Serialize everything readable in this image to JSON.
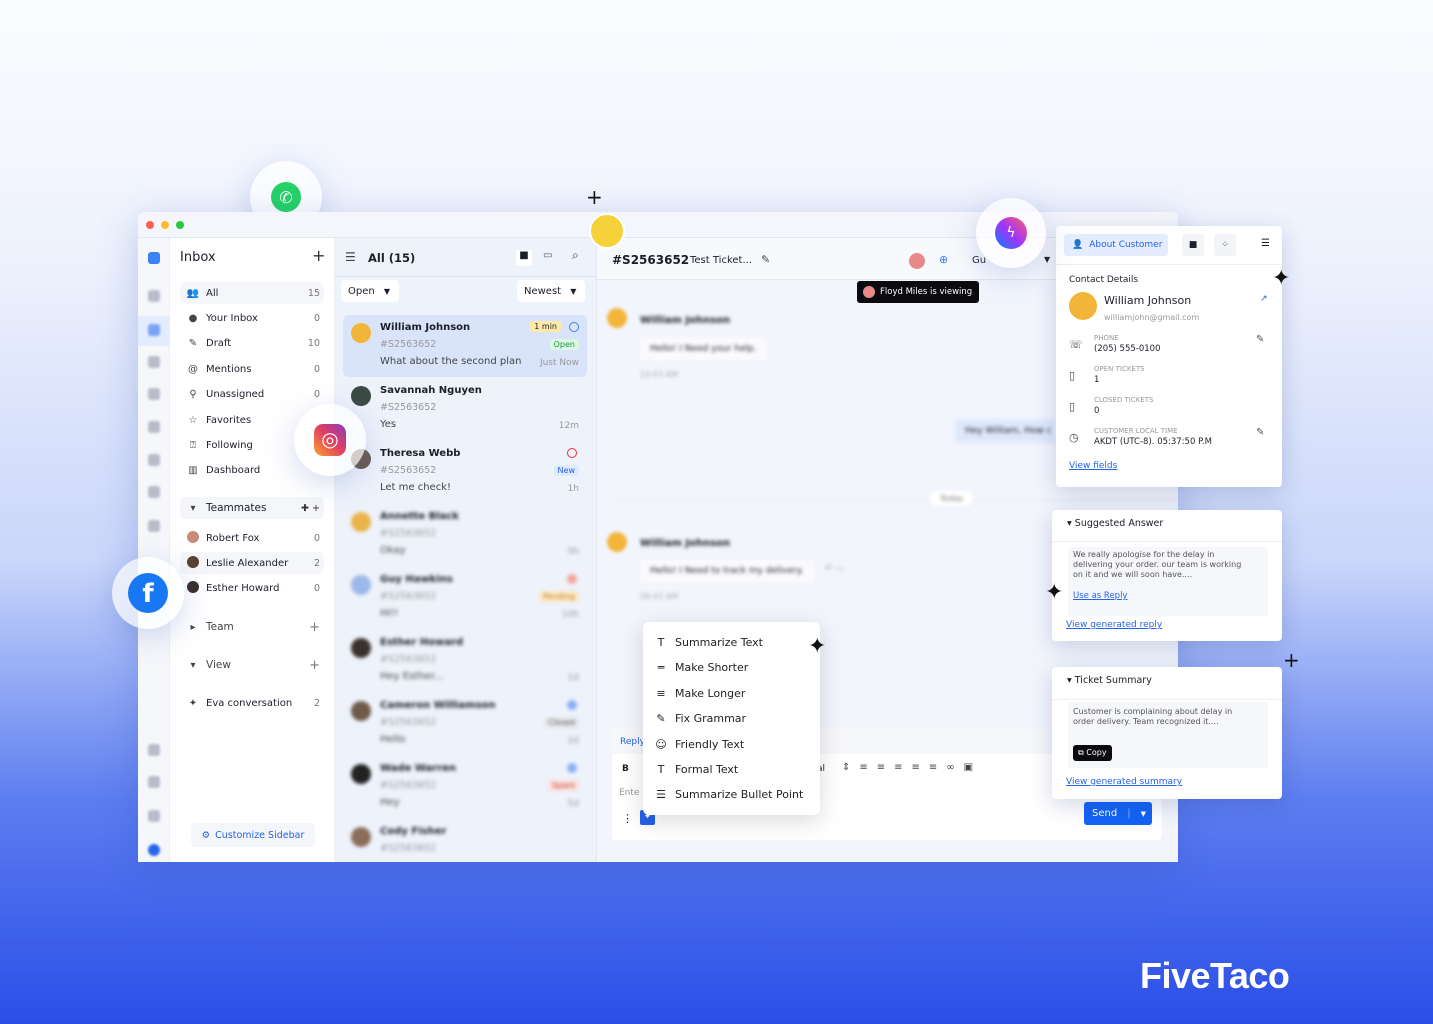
{
  "brand": "FiveTaco",
  "sidebar": {
    "title": "Inbox",
    "items": [
      {
        "label": "All",
        "count": "15",
        "icon": "users-icon"
      },
      {
        "label": "Your Inbox",
        "count": "0",
        "icon": "inbox-icon"
      },
      {
        "label": "Draft",
        "count": "10",
        "icon": "draft-icon"
      },
      {
        "label": "Mentions",
        "count": "0",
        "icon": "at-icon"
      },
      {
        "label": "Unassigned",
        "count": "0",
        "icon": "unassigned-icon"
      },
      {
        "label": "Favorites",
        "count": "",
        "icon": "star-icon"
      },
      {
        "label": "Following",
        "count": "",
        "icon": "following-icon"
      },
      {
        "label": "Dashboard",
        "count": "",
        "icon": "chart-icon"
      }
    ],
    "teammates_label": "Teammates",
    "teammates": [
      {
        "name": "Robert Fox",
        "count": "0"
      },
      {
        "name": "Leslie Alexander",
        "count": "2"
      },
      {
        "name": "Esther Howard",
        "count": "0"
      }
    ],
    "team_label": "Team",
    "view_label": "View",
    "eva_label": "Eva conversation",
    "eva_count": "2",
    "customize_label": "Customize Sidebar"
  },
  "list": {
    "title": "All (15)",
    "filter": "Open",
    "sort": "Newest",
    "conversations": [
      {
        "name": "William Johnson",
        "ticket": "#S2563652",
        "message": "What about the second plan",
        "time": "Just Now",
        "badge": "Open",
        "timer": "1 min",
        "badge_color": "#1a9a4a",
        "badge_bg": "#dcf7e3",
        "avatar": "#f2b53a"
      },
      {
        "name": "Savannah Nguyen",
        "ticket": "#S2563652",
        "message": "Yes",
        "time": "12m",
        "badge": "",
        "avatar": "#3b4a44"
      },
      {
        "name": "Theresa Webb",
        "ticket": "#S2563652",
        "message": "Let me check!",
        "time": "1h",
        "badge": "New",
        "badge_color": "#2563eb",
        "badge_bg": "#e0eaff",
        "avatar": "#6b5a4e",
        "status": "#e33"
      },
      {
        "name": "Annette Black",
        "ticket": "#S2563652",
        "message": "Okay",
        "time": "5h",
        "badge": "",
        "avatar": "#e8b44a"
      },
      {
        "name": "Guy Hawkins",
        "ticket": "#S2563652",
        "message": "Hi!!",
        "time": "10h",
        "badge": "Pending",
        "badge_color": "#c07a10",
        "badge_bg": "#fde9c8",
        "avatar": "#9ab8e8",
        "status": "#f4a89a"
      },
      {
        "name": "Esther Howard",
        "ticket": "#S2563652",
        "message": "Hey Esther...",
        "time": "1d",
        "badge": "",
        "avatar": "#3a302c"
      },
      {
        "name": "Cameron Williamson",
        "ticket": "#S2563652",
        "message": "Hello",
        "time": "2d",
        "badge": "Closed",
        "badge_color": "#555",
        "badge_bg": "#e7e7ec",
        "avatar": "#6d5a4a",
        "status": "#8ab0f6"
      },
      {
        "name": "Wade Warren",
        "ticket": "#S2563652",
        "message": "Hey",
        "time": "5d",
        "badge": "Spam",
        "badge_color": "#c0392b",
        "badge_bg": "#fde0dc",
        "avatar": "#222",
        "status": "#8ab0f6"
      },
      {
        "name": "Cody Fisher",
        "ticket": "#S2563652",
        "message": "",
        "time": "",
        "badge": "",
        "avatar": "#8a6d5a"
      }
    ]
  },
  "chat": {
    "ticket_id": "#S2563652",
    "ticket_title": "Test Ticket...",
    "assignee_partial": "Gu",
    "viewing_tooltip": "Floyd Miles is viewing",
    "messages": [
      {
        "sender": "William Johnson",
        "text": "Hello! I Need your help.",
        "time": "10:03 AM"
      },
      {
        "text": "Hey William, How c"
      },
      {
        "divider": "Today"
      },
      {
        "sender": "William Johnson",
        "text": "Hello! I Need to track my delivery.",
        "time": "08:42 AM"
      }
    ],
    "reply_tab": "Reply",
    "bold": "B",
    "font_partial": "al",
    "input_placeholder_partial": "Ente",
    "send_label": "Send"
  },
  "ai_menu": [
    {
      "icon": "T",
      "label": "Summarize Text"
    },
    {
      "icon": "═",
      "label": "Make Shorter"
    },
    {
      "icon": "≡",
      "label": "Make Longer"
    },
    {
      "icon": "✎",
      "label": "Fix Grammar"
    },
    {
      "icon": "☺",
      "label": "Friendly Text"
    },
    {
      "icon": "T",
      "label": "Formal Text"
    },
    {
      "icon": "☰",
      "label": "Summarize Bullet Point"
    }
  ],
  "customer": {
    "tab_label": "About Customer",
    "section": "Contact Details",
    "name": "William Johnson",
    "email": "williamjohn@gmail.com",
    "fields": [
      {
        "label": "PHONE",
        "value": "(205) 555-0100"
      },
      {
        "label": "OPEN TICKETS",
        "value": "1"
      },
      {
        "label": "CLOSED TICKETS",
        "value": "0"
      },
      {
        "label": "CUSTOMER LOCAL TIME",
        "value": "AKDT (UTC-8). 05:37:50 P.M"
      }
    ],
    "view_fields": "View fields"
  },
  "suggested": {
    "title": "Suggested Answer",
    "text": "We really apologise for the delay in delivering your order. our team is working on it and we will soon have....",
    "use_reply": "Use as Reply",
    "view_link": "View generated reply"
  },
  "summary": {
    "title": "Ticket Summary",
    "text": "Customer is complaining about delay in order delivery. Team recognized it....",
    "copy": "Copy",
    "view_link": "View generated summary"
  },
  "colors": {
    "accent": "#2563eb",
    "whatsapp": "#25d366",
    "facebook": "#1877f2"
  }
}
